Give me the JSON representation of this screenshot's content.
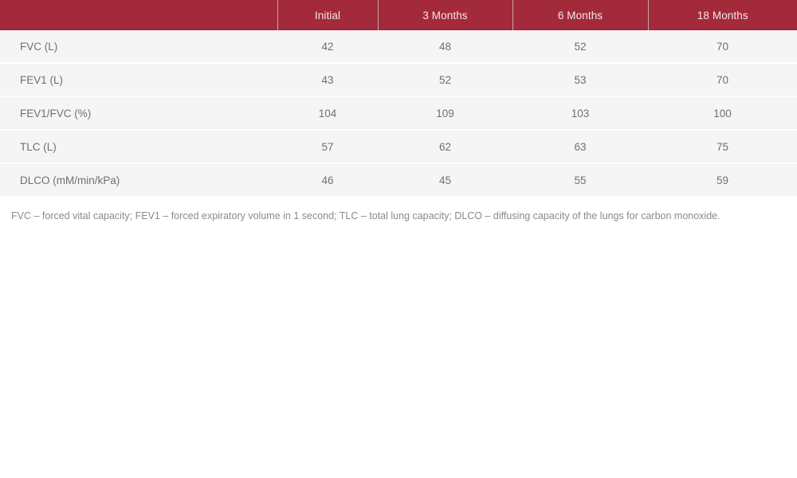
{
  "table": {
    "columns": [
      {
        "key": "label",
        "label": ""
      },
      {
        "key": "initial",
        "label": "Initial"
      },
      {
        "key": "m3",
        "label": "3 Months"
      },
      {
        "key": "m6",
        "label": "6 Months"
      },
      {
        "key": "m18",
        "label": "18 Months"
      }
    ],
    "rows": [
      {
        "label": "FVC (L)",
        "initial": "42",
        "m3": "48",
        "m6": "52",
        "m18": "70"
      },
      {
        "label": "FEV1 (L)",
        "initial": "43",
        "m3": "52",
        "m6": "53",
        "m18": "70"
      },
      {
        "label": "FEV1/FVC (%)",
        "initial": "104",
        "m3": "109",
        "m6": "103",
        "m18": "100"
      },
      {
        "label": "TLC (L)",
        "initial": "57",
        "m3": "62",
        "m6": "63",
        "m18": "75"
      },
      {
        "label": "DLCO (mM/min/kPa)",
        "initial": "46",
        "m3": "45",
        "m6": "55",
        "m18": "59"
      }
    ],
    "footnote": "FVC – forced vital capacity; FEV1 – forced expiratory volume in 1 second; TLC – total lung capacity; DLCO – diffusing capacity of the lungs for carbon monoxide."
  },
  "colors": {
    "header_background": "#a32a3a",
    "header_text": "#f3e6e8",
    "row_background": "#f5f5f5",
    "row_text": "#6f6f6f",
    "footnote_text": "#8a8a8a",
    "divider": "#c9a3ab"
  }
}
